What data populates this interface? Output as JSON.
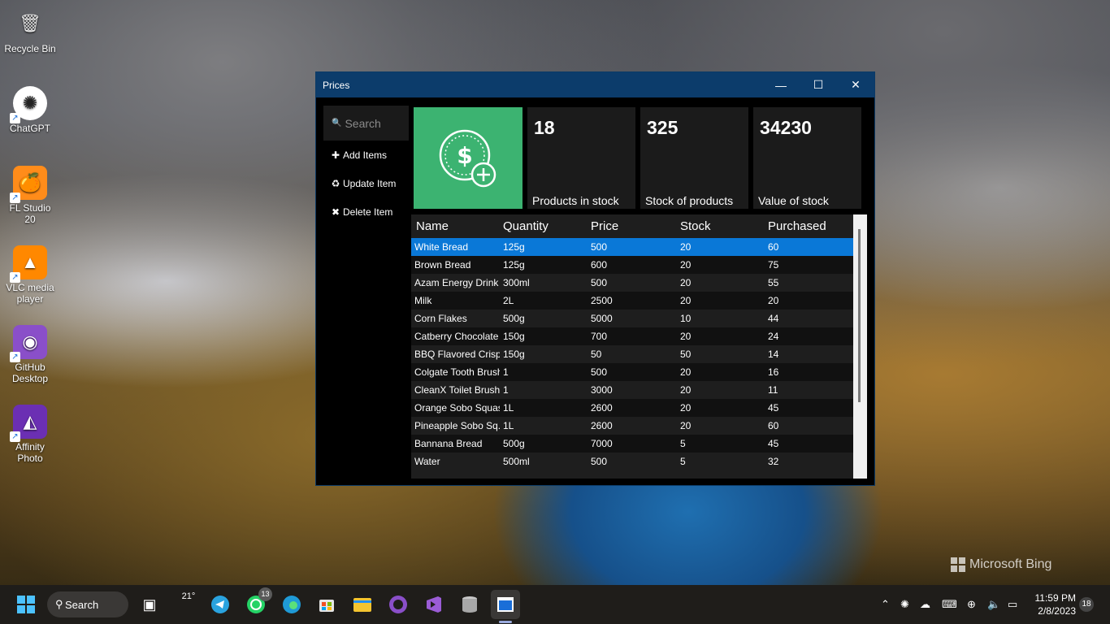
{
  "desktop": {
    "icons": [
      {
        "label": "Recycle Bin",
        "icon": "recycle-bin-icon",
        "glyph": "🗑"
      },
      {
        "label": "ChatGPT",
        "icon": "chatgpt-icon",
        "glyph": "✺"
      },
      {
        "label": "FL Studio 20",
        "icon": "fl-studio-icon",
        "glyph": "🍊"
      },
      {
        "label": "VLC media player",
        "icon": "vlc-icon",
        "glyph": "▲"
      },
      {
        "label": "GitHub Desktop",
        "icon": "github-desktop-icon",
        "glyph": "◉"
      },
      {
        "label": "Affinity Photo",
        "icon": "affinity-photo-icon",
        "glyph": "◭"
      }
    ],
    "watermark": "Microsoft Bing"
  },
  "window": {
    "title": "Prices",
    "minimize": "—",
    "maximize": "☐",
    "close": "✕"
  },
  "sidebar": {
    "search_placeholder": "Search",
    "add_label": "Add Items",
    "update_label": "Update Item",
    "delete_label": "Delete Item"
  },
  "stats": [
    {
      "value": "18",
      "label": "Products in stock"
    },
    {
      "value": "325",
      "label": "Stock of products"
    },
    {
      "value": "34230",
      "label": "Value of stock"
    }
  ],
  "table": {
    "columns": [
      "Name",
      "Quantity",
      "Price",
      "Stock",
      "Purchased"
    ],
    "selected_index": 0,
    "rows": [
      [
        "White Bread",
        "125g",
        "500",
        "20",
        "60"
      ],
      [
        "Brown Bread",
        "125g",
        "600",
        "20",
        "75"
      ],
      [
        "Azam Energy Drink",
        "300ml",
        "500",
        "20",
        "55"
      ],
      [
        "Milk",
        "2L",
        "2500",
        "20",
        "20"
      ],
      [
        "Corn Flakes",
        "500g",
        "5000",
        "10",
        "44"
      ],
      [
        "Catberry Chocolate ...",
        "150g",
        "700",
        "20",
        "24"
      ],
      [
        "BBQ Flavored Crisps",
        "150g",
        "50",
        "50",
        "14"
      ],
      [
        "Colgate Tooth Brush",
        "1",
        "500",
        "20",
        "16"
      ],
      [
        "CleanX Toilet Brush",
        "1",
        "3000",
        "20",
        "11"
      ],
      [
        "Orange Sobo Squash",
        "1L",
        "2600",
        "20",
        "45"
      ],
      [
        "Pineapple Sobo Sq...",
        "1L",
        "2600",
        "20",
        "60"
      ],
      [
        "Bannana Bread",
        "500g",
        "7000",
        "5",
        "45"
      ],
      [
        "Water",
        "500ml",
        "500",
        "5",
        "32"
      ]
    ]
  },
  "taskbar": {
    "search_label": "Search",
    "weather": "21°",
    "whatsapp_badge": "13",
    "time": "11:59 PM",
    "date": "2/8/2023",
    "notification_count": "18"
  },
  "colors": {
    "accent_green": "#3cb371",
    "selection_blue": "#0a78d7",
    "titlebar_blue": "#0c3c6b"
  }
}
